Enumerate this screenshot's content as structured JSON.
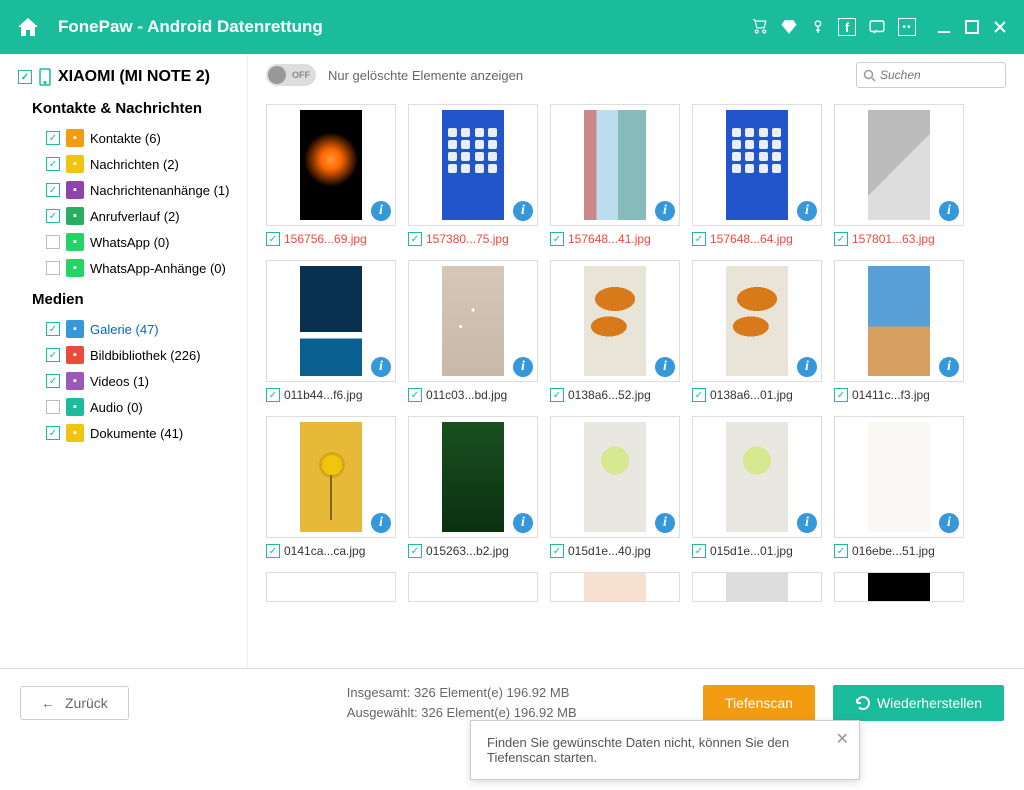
{
  "app": {
    "title": "FonePaw - Android Datenrettung"
  },
  "device": {
    "name": "XIAOMI (MI NOTE 2)"
  },
  "sections": {
    "contacts": "Kontakte & Nachrichten",
    "media": "Medien"
  },
  "sidebar": {
    "contacts": [
      {
        "label": "Kontakte",
        "count": 6,
        "checked": true,
        "color": "#f39c12"
      },
      {
        "label": "Nachrichten",
        "count": 2,
        "checked": true,
        "color": "#f1c40f"
      },
      {
        "label": "Nachrichtenanhänge",
        "count": 1,
        "checked": true,
        "color": "#8e44ad"
      },
      {
        "label": "Anrufverlauf",
        "count": 2,
        "checked": true,
        "color": "#27ae60"
      },
      {
        "label": "WhatsApp",
        "count": 0,
        "checked": false,
        "color": "#25d366"
      },
      {
        "label": "WhatsApp-Anhänge",
        "count": 0,
        "checked": false,
        "color": "#25d366"
      }
    ],
    "media": [
      {
        "label": "Galerie",
        "count": 47,
        "checked": true,
        "active": true,
        "color": "#3498db"
      },
      {
        "label": "Bildbibliothek",
        "count": 226,
        "checked": true,
        "color": "#e74c3c"
      },
      {
        "label": "Videos",
        "count": 1,
        "checked": true,
        "color": "#9b59b6"
      },
      {
        "label": "Audio",
        "count": 0,
        "checked": false,
        "color": "#1abc9c"
      },
      {
        "label": "Dokumente",
        "count": 41,
        "checked": true,
        "color": "#f1c40f"
      }
    ]
  },
  "toolbar": {
    "toggle_state": "OFF",
    "toggle_label": "Nur gelöschte Elemente anzeigen",
    "search_placeholder": "Suchen"
  },
  "gallery": [
    [
      {
        "name": "156756...69.jpg",
        "deleted": true,
        "bg": "#0a0a0a",
        "fg": "radial-gradient(circle at 50% 45%, #ff9933 0%, #ff6600 15%, #000 40%)"
      },
      {
        "name": "157380...75.jpg",
        "deleted": true,
        "bg": "#1a3a5a",
        "fg": "linear-gradient(#4a90d9,#4a90d9)"
      },
      {
        "name": "157648...41.jpg",
        "deleted": true,
        "bg": "#d0e8e0",
        "fg": "linear-gradient(90deg,#c88 0 20%, #bde 20% 55%, #8bb 55%)"
      },
      {
        "name": "157648...64.jpg",
        "deleted": true,
        "bg": "#1a3a7a",
        "fg": "linear-gradient(#2255cc,#2255cc)"
      },
      {
        "name": "157801...63.jpg",
        "deleted": true,
        "bg": "#ccc",
        "fg": "linear-gradient(135deg,#bbb 0 50%,#ddd 50%)"
      }
    ],
    [
      {
        "name": "011b44...f6.jpg",
        "deleted": false,
        "bg": "#0a2540",
        "fg": "linear-gradient(#0a3050 60%, #fff 60% 66%, #0a6090 66%)"
      },
      {
        "name": "011c03...bd.jpg",
        "deleted": false,
        "bg": "#d4c8b8",
        "fg": "radial-gradient(circle at 50% 40%, #fff 0 2%, transparent 2%), radial-gradient(circle at 30% 55%, #fff 0 2%, transparent 2%), linear-gradient(#d4c8b8,#c8b8a8)"
      },
      {
        "name": "0138a6...52.jpg",
        "deleted": false,
        "bg": "#e8e4d8",
        "fg": "linear-gradient(#e8e4d8,#e8e4d8)"
      },
      {
        "name": "0138a6...01.jpg",
        "deleted": false,
        "bg": "#e8e4d8",
        "fg": "linear-gradient(#e8e4d8,#e8e4d8)"
      },
      {
        "name": "01411c...f3.jpg",
        "deleted": false,
        "bg": "#5aa0d8",
        "fg": "linear-gradient(#5aa0d8 55%, #d8a060 55%)"
      }
    ],
    [
      {
        "name": "0141ca...ca.jpg",
        "deleted": false,
        "bg": "#e8b838",
        "fg": "linear-gradient(#e8b838,#e8b838)"
      },
      {
        "name": "015263...b2.jpg",
        "deleted": false,
        "bg": "#0a3010",
        "fg": "linear-gradient(#1a5020,#0a3010)"
      },
      {
        "name": "015d1e...40.jpg",
        "deleted": false,
        "bg": "#e8e8e0",
        "fg": "radial-gradient(circle at 50% 35%, #d8e890 0 18%, transparent 18%), linear-gradient(#e8e8e0,#e8e8e0)"
      },
      {
        "name": "015d1e...01.jpg",
        "deleted": false,
        "bg": "#e8e8e0",
        "fg": "radial-gradient(circle at 50% 35%, #d8e890 0 18%, transparent 18%), linear-gradient(#e8e8e0,#e8e8e0)"
      },
      {
        "name": "016ebe...51.jpg",
        "deleted": false,
        "bg": "#faf8f4",
        "fg": "linear-gradient(#faf8f4,#faf8f4)"
      }
    ],
    [
      {
        "name": "",
        "deleted": false,
        "bg": "#fff",
        "fg": "linear-gradient(#fff,#fff)"
      },
      {
        "name": "",
        "deleted": false,
        "bg": "#fff",
        "fg": "linear-gradient(#fff,#fff)"
      },
      {
        "name": "",
        "deleted": false,
        "bg": "#f8e0d0",
        "fg": "linear-gradient(#f8e0d0,#f8e0d0)"
      },
      {
        "name": "",
        "deleted": false,
        "bg": "#ddd",
        "fg": "linear-gradient(#ddd,#ddd)"
      },
      {
        "name": "",
        "deleted": false,
        "bg": "#000",
        "fg": "linear-gradient(#000,#000)"
      }
    ]
  ],
  "footer": {
    "back": "Zurück",
    "total_label": "Insgesamt:",
    "total_value": "326 Element(e) 196.92 MB",
    "selected_label": "Ausgewählt:",
    "selected_value": "326 Element(e) 196.92 MB",
    "deepscan": "Tiefenscan",
    "recover": "Wiederherstellen"
  },
  "popup": {
    "text": "Finden Sie gewünschte Daten nicht, können Sie den Tiefenscan starten."
  }
}
